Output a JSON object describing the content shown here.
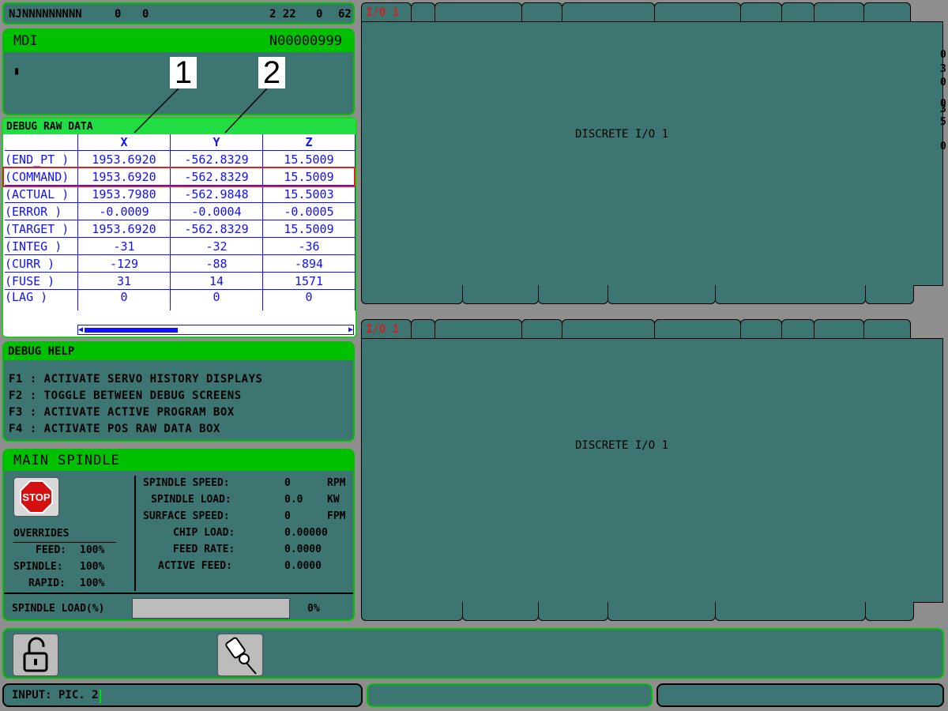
{
  "status_bar": {
    "name": "NJNNNNNNNNN",
    "val1": "0",
    "val2": "0",
    "val3": "2 22",
    "val4": "0",
    "val5": "62"
  },
  "mdi": {
    "title": "MDI",
    "program": "N00000999",
    "cursor": "▮"
  },
  "debug_raw": {
    "title": "DEBUG RAW DATA",
    "columns": [
      "X",
      "Y",
      "Z"
    ],
    "rows": [
      {
        "label": "(END_PT )",
        "x": "1953.6920",
        "y": "-562.8329",
        "z": "15.5009"
      },
      {
        "label": "(COMMAND)",
        "x": "1953.6920",
        "y": "-562.8329",
        "z": "15.5009"
      },
      {
        "label": "(ACTUAL )",
        "x": "1953.7980",
        "y": "-562.9848",
        "z": "15.5003"
      },
      {
        "label": "(ERROR  )",
        "x": "-0.0009",
        "y": "-0.0004",
        "z": "-0.0005"
      },
      {
        "label": "(TARGET )",
        "x": "1953.6920",
        "y": "-562.8329",
        "z": "15.5009"
      },
      {
        "label": "(INTEG  )",
        "x": "-31",
        "y": "-32",
        "z": "-36"
      },
      {
        "label": "(CURR   )",
        "x": "-129",
        "y": "-88",
        "z": "-894"
      },
      {
        "label": "(FUSE   )",
        "x": "31",
        "y": "14",
        "z": "1571"
      },
      {
        "label": "(LAG    )",
        "x": "0",
        "y": "0",
        "z": "0"
      }
    ],
    "callout_1": "1",
    "callout_2": "2",
    "scroll_left": "◀",
    "scroll_right": "▶"
  },
  "debug_help": {
    "title": "DEBUG HELP",
    "lines": [
      "F1 : ACTIVATE SERVO HISTORY DISPLAYS",
      "F2 : TOGGLE BETWEEN DEBUG SCREENS",
      "F3 : ACTIVATE ACTIVE PROGRAM BOX",
      "F4 : ACTIVATE POS RAW DATA BOX"
    ]
  },
  "spindle": {
    "title": "MAIN SPINDLE",
    "stop_label": "STOP",
    "overrides_title": "OVERRIDES",
    "feed_label": "FEED:",
    "feed_value": "100%",
    "spindle_label": "SPINDLE:",
    "spindle_value": "100%",
    "rapid_label": "RAPID:",
    "rapid_value": "100%",
    "speed_label": "SPINDLE SPEED:",
    "speed_value": "0",
    "speed_unit": "RPM",
    "load_label": "SPINDLE LOAD:",
    "load_value": "0.0",
    "load_unit": "KW",
    "surface_label": "SURFACE SPEED:",
    "surface_value": "0",
    "surface_unit": "FPM",
    "chip_label": "CHIP LOAD:",
    "chip_value": "0.00000",
    "feedrate_label": "FEED RATE:",
    "feedrate_value": "0.0000",
    "active_label": "ACTIVE FEED:",
    "active_value": "0.0000",
    "load_pct_label": "SPINDLE LOAD(%)",
    "load_pct_value": "0%",
    "load_pct_fill": 0
  },
  "input": {
    "text": "INPUT: PIC. 2"
  },
  "io_panel": {
    "active_tab": "I/O 1",
    "body_title": "DISCRETE I/O 1",
    "edge_fragments": [
      "0",
      "3",
      "0",
      "0",
      "3",
      "5",
      "0"
    ]
  },
  "colors": {
    "panel": "#3c7572",
    "header_green": "#00c000",
    "data_blue": "#1010ff",
    "highlight_red": "#e02020"
  }
}
